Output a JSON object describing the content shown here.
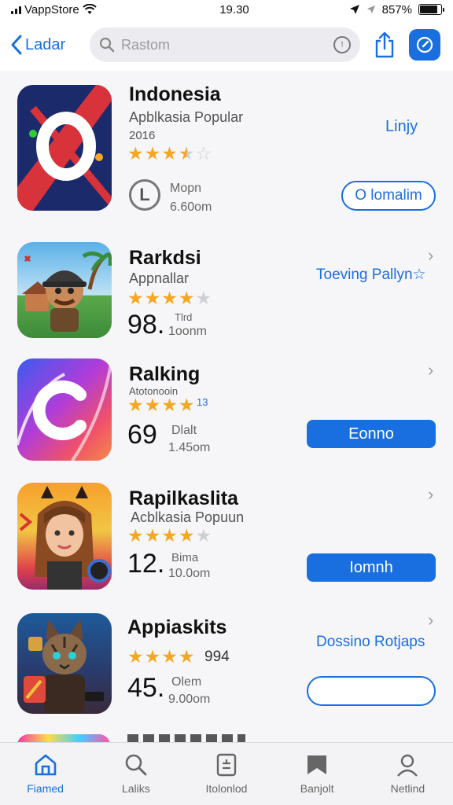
{
  "status": {
    "carrier": "VappStore",
    "time": "19.30",
    "battery": "857%"
  },
  "nav": {
    "back_label": "Ladar",
    "search_placeholder": "Rastom"
  },
  "apps": [
    {
      "name": "Indonesia",
      "subtitle": "Apblkasia Popular",
      "year": "2016",
      "rating": 3.5,
      "action_link": "Linjy",
      "size_label": "Mopn",
      "size_value": "6.60om",
      "button": "O lomalim"
    },
    {
      "name": "Rarkdsi",
      "subtitle": "Appnallar",
      "rating": 4.5,
      "link": "Toeving Pallyn☆",
      "big_number": "98.",
      "meta_top": "Tlrd",
      "meta_bottom": "1oonm"
    },
    {
      "name": "Ralking",
      "subtitle": "Atotonooin",
      "rating": 4.5,
      "rating_note": "13",
      "big_number": "69",
      "meta_top": "Dlalt",
      "meta_bottom": "1.45om",
      "button": "Eonno"
    },
    {
      "name": "Rapilkaslita",
      "subtitle": "Acblkasia Popuun",
      "rating": 4,
      "big_number": "12.",
      "meta_top": "Bima",
      "meta_bottom": "10.0om",
      "button": "Iomnh"
    },
    {
      "name": "Appiaskits",
      "rating": 4,
      "rating_count": "994",
      "link": "Dossino Rotjaps",
      "big_number": "45.",
      "meta_top": "Olem",
      "meta_bottom": "9.00om",
      "button": ""
    }
  ],
  "tabs": [
    {
      "label": "Fiamed",
      "icon": "home-icon",
      "active": true
    },
    {
      "label": "Laliks",
      "icon": "search-icon",
      "active": false
    },
    {
      "label": "Itolonlod",
      "icon": "list-icon",
      "active": false
    },
    {
      "label": "Banjolt",
      "icon": "bookmark-icon",
      "active": false
    },
    {
      "label": "Netlind",
      "icon": "person-icon",
      "active": false
    }
  ],
  "colors": {
    "accent": "#1a6fe0",
    "star": "#f5a623"
  }
}
